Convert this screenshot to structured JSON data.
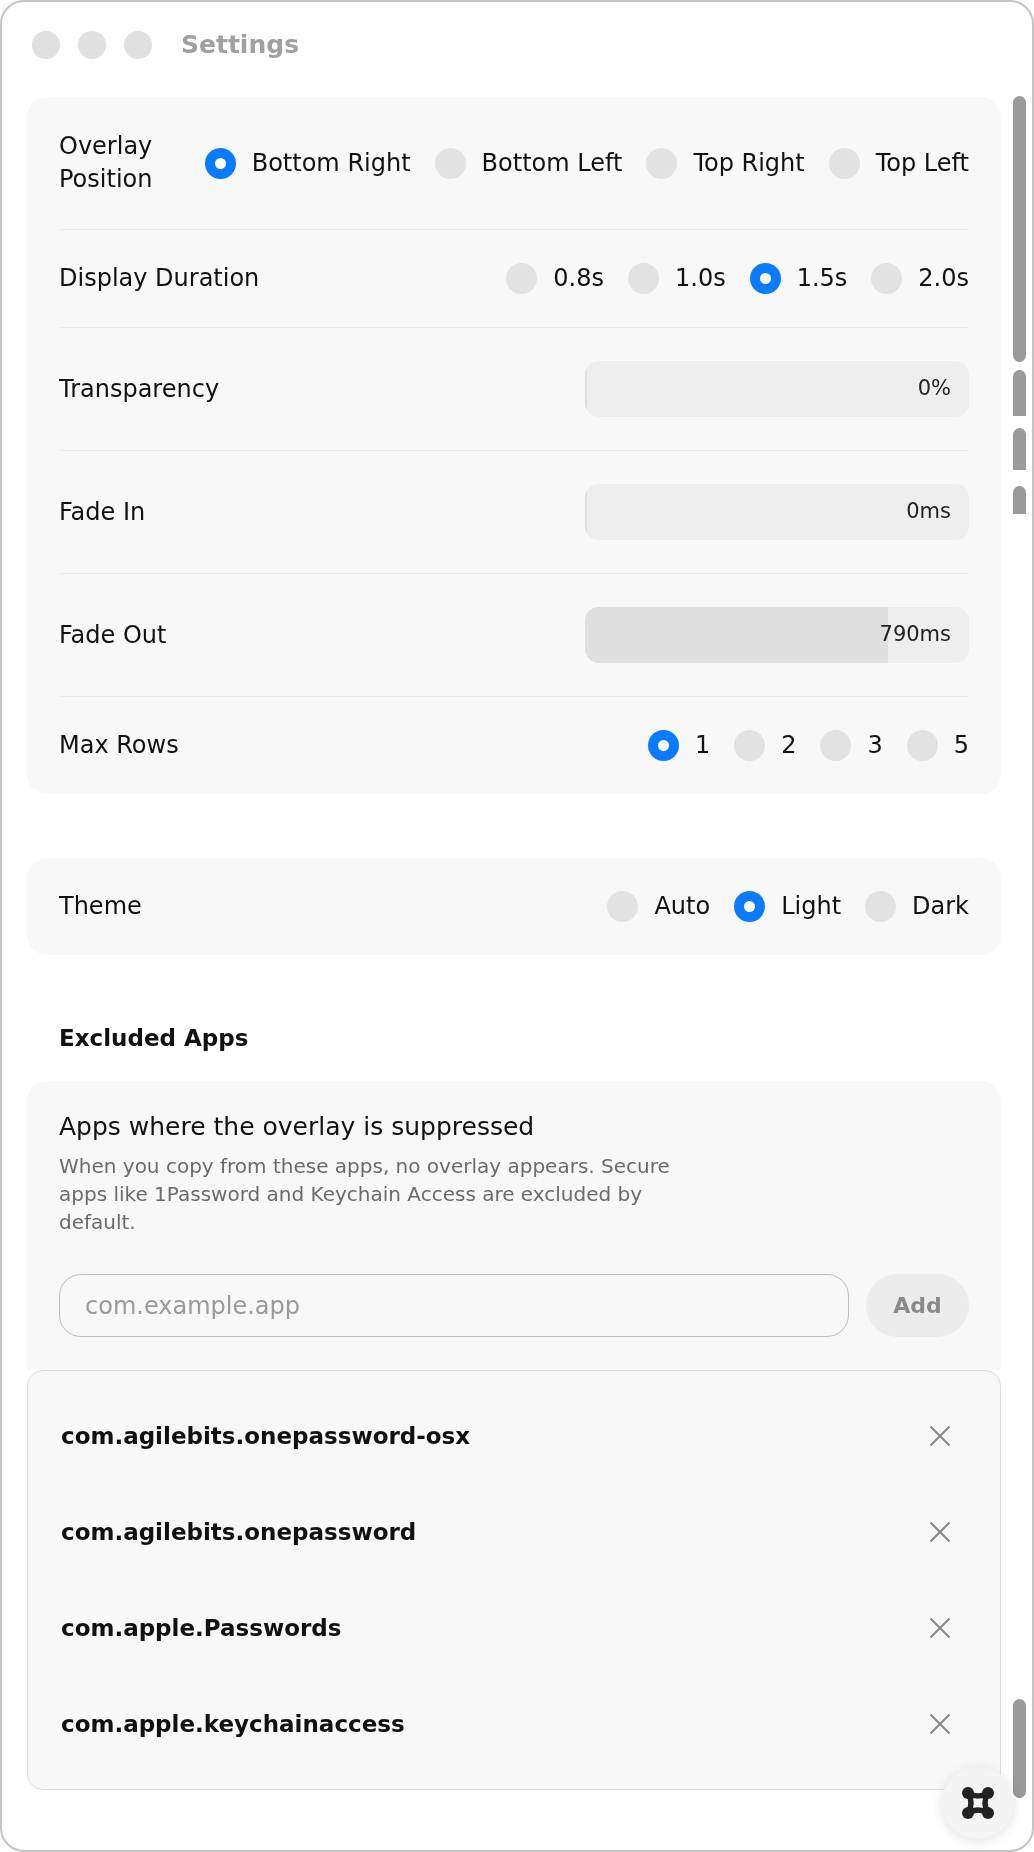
{
  "window": {
    "title": "Settings"
  },
  "general": [
    {
      "kind": "choice",
      "label": "Overlay Position",
      "options": [
        {
          "label": "Bottom Right",
          "selected": true
        },
        {
          "label": "Bottom Left",
          "selected": false
        },
        {
          "label": "Top Right",
          "selected": false
        },
        {
          "label": "Top Left",
          "selected": false
        }
      ]
    },
    {
      "kind": "choice",
      "label": "Display Duration",
      "options": [
        {
          "label": "0.8s",
          "selected": false
        },
        {
          "label": "1.0s",
          "selected": false
        },
        {
          "label": "1.5s",
          "selected": true
        },
        {
          "label": "2.0s",
          "selected": false
        }
      ]
    },
    {
      "kind": "slider",
      "label": "Transparency",
      "level": 0,
      "reading": "0%"
    },
    {
      "kind": "slider",
      "label": "Fade In",
      "level": 0,
      "reading": "0ms"
    },
    {
      "kind": "slider",
      "label": "Fade Out",
      "level": 0.79,
      "reading": "790ms"
    },
    {
      "kind": "choice",
      "label": "Max Rows",
      "options": [
        {
          "label": "1",
          "selected": true
        },
        {
          "label": "2",
          "selected": false
        },
        {
          "label": "3",
          "selected": false
        },
        {
          "label": "5",
          "selected": false
        }
      ]
    }
  ],
  "appearance": [
    {
      "kind": "choice",
      "label": "Theme",
      "options": [
        {
          "label": "Auto",
          "selected": false
        },
        {
          "label": "Light",
          "selected": true
        },
        {
          "label": "Dark",
          "selected": false
        }
      ]
    }
  ],
  "excluded_apps": {
    "heading": "Excluded Apps",
    "title": "Apps where the overlay is suppressed",
    "description": "When you copy from these apps, no overlay appears. Secure apps like 1Password and Keychain Access are excluded by default.",
    "input": {
      "placeholder": "com.example.app"
    },
    "add_button": "Add",
    "apps": [
      {
        "name": "com.agilebits.onepassword-osx"
      },
      {
        "name": "com.agilebits.onepassword"
      },
      {
        "name": "com.apple.Passwords"
      },
      {
        "name": "com.apple.keychainaccess"
      }
    ]
  }
}
